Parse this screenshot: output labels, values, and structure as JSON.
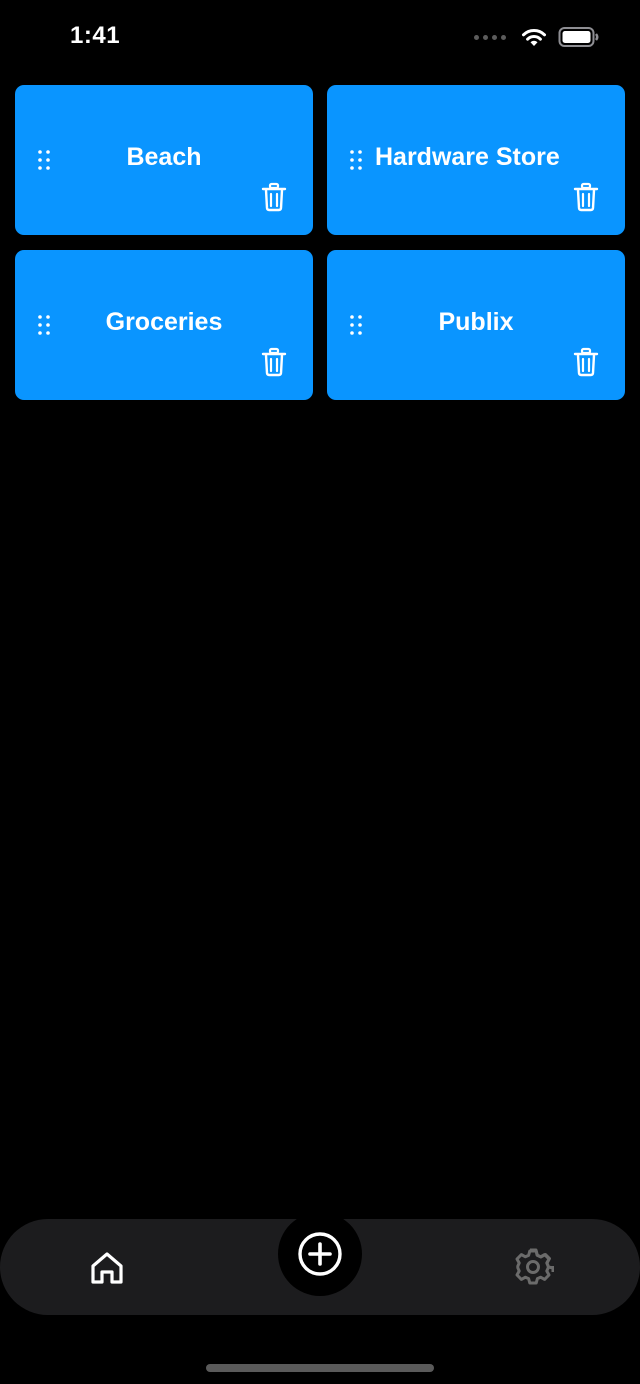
{
  "status_bar": {
    "time": "1:41"
  },
  "lists": [
    {
      "title": "Beach",
      "icon_drag": "drag-handle-icon",
      "icon_delete": "trash-icon"
    },
    {
      "title": "Hardware Store",
      "icon_drag": "drag-handle-icon",
      "icon_delete": "trash-icon"
    },
    {
      "title": "Groceries",
      "icon_drag": "drag-handle-icon",
      "icon_delete": "trash-icon"
    },
    {
      "title": "Publix",
      "icon_drag": "drag-handle-icon",
      "icon_delete": "trash-icon"
    }
  ],
  "tab_bar": {
    "home_icon": "home-icon",
    "add_icon": "plus-circle-icon",
    "settings_icon": "gear-icon"
  },
  "colors": {
    "background": "#000000",
    "card": "#0a95ff",
    "tab_bar": "#1c1c1e",
    "settings_icon": "#6b6b6b"
  }
}
